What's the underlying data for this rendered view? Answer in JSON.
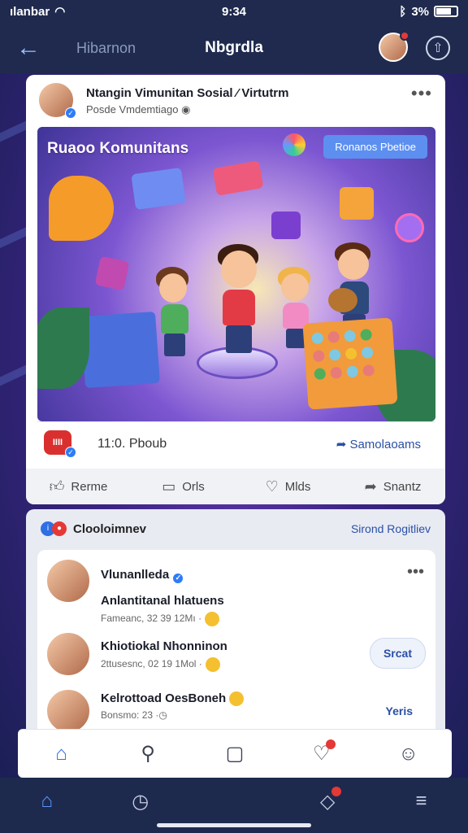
{
  "status_bar": {
    "carrier": "ılanbar",
    "time": "9:34",
    "battery": "3%"
  },
  "header": {
    "subtitle": "Hibarnon",
    "title": "Nbgrdla"
  },
  "post": {
    "author": "Ntangin Vimunitan Sosial ⁄ Virtutrm",
    "meta": "Posde Vmdemtiago",
    "hero": {
      "title": "Ruaoo Komunitans",
      "button": "Ronanos Pbetioe"
    },
    "reaction_label": "IIII",
    "reaction_count": "11:0. Pboub",
    "share_link": "Samolaoams"
  },
  "actions": [
    {
      "label": "Rerme",
      "icon": "thumbs-up-icon"
    },
    {
      "label": "Orls",
      "icon": "comment-icon"
    },
    {
      "label": "Mlds",
      "icon": "heart-icon"
    },
    {
      "label": "Snantz",
      "icon": "share-arrow-icon"
    }
  ],
  "friends": {
    "heading": "Clooloimnev",
    "link": "Sirond Rogitliev",
    "items": [
      {
        "name": "Vlunanlleda",
        "sub": "",
        "button": ""
      },
      {
        "name": "Anlantitanal hlatuens",
        "sub": "Fameanc, 32  39  12Mı ·",
        "button": ""
      },
      {
        "name": "Khiotiokal Nhonninon",
        "sub": "2ttusesnc, 02  19  1Mol ·",
        "button": "Srcat"
      },
      {
        "name": "Kelrottoad OesBoneh",
        "sub": "Bonsmo: 23  ·",
        "button": "Yeris"
      }
    ]
  },
  "colors": {
    "accent": "#2f6fe4",
    "header_bg": "#1f2a4e",
    "link": "#2a4fa5",
    "badge": "#e53935"
  }
}
